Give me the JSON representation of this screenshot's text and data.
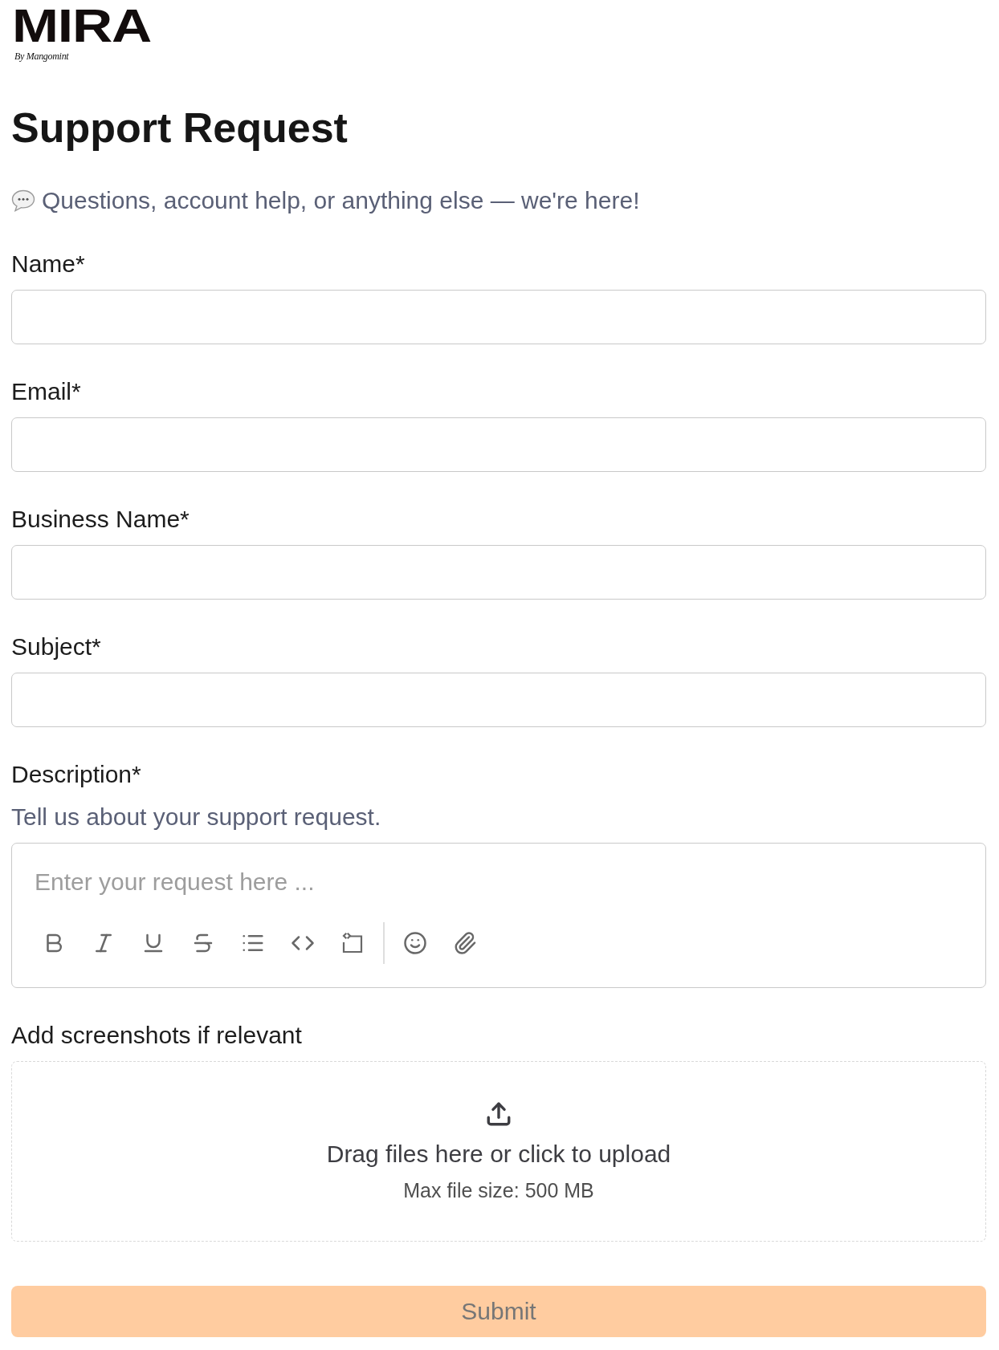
{
  "logo": {
    "wordmark": "MIRA",
    "tagline": "By Mangomint"
  },
  "title": "Support Request",
  "intro": "Questions, account help, or anything else — we're here!",
  "fields": [
    {
      "kind": "text",
      "label": "Name*"
    },
    {
      "kind": "text",
      "label": "Email*"
    },
    {
      "kind": "text",
      "label": "Business Name*"
    },
    {
      "kind": "text",
      "label": "Subject*"
    },
    {
      "kind": "rich_text",
      "label": "Description*",
      "help": "Tell us about your support request.",
      "placeholder": "Enter your request here ..."
    },
    {
      "kind": "upload",
      "label": "Add screenshots if relevant",
      "prompt": "Drag files here or click to upload",
      "note": "Max file size: 500 MB"
    }
  ],
  "submit": {
    "label": "Submit",
    "disabled": true
  }
}
